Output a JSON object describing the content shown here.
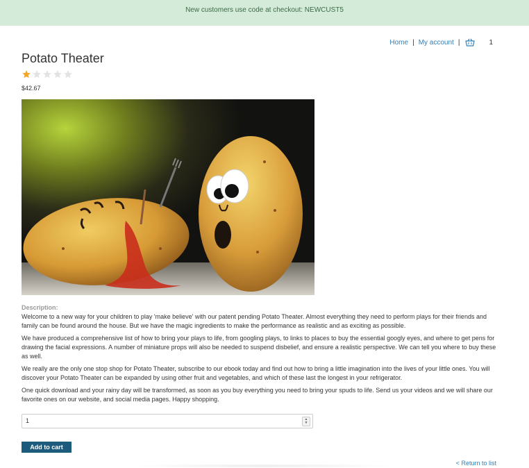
{
  "banner": {
    "text": "New customers use code at checkout: NEWCUST5"
  },
  "nav": {
    "home": "Home",
    "separator": "|",
    "my_account": "My account",
    "cart_icon": "basket-icon",
    "cart_count": "1"
  },
  "product": {
    "title": "Potato Theater",
    "rating": {
      "value": 1,
      "max": 5
    },
    "price": "$42.67",
    "image_alt": "product-photo"
  },
  "description": {
    "label": "Description:",
    "paragraphs": [
      "Welcome to a new way for your children to play 'make believe' with our patent pending Potato Theater. Almost everything they need to perform plays for their friends and family can be found around the house. But we have the magic ingredients to make the performance as realistic and as exciting as possible.",
      "We have produced a comprehensive list of how to bring your plays to life, from googling plays, to links to places to buy the essential googly eyes, and where to get pens for drawing the facial expressions. A number of miniature props will also be needed to suspend disbelief, and ensure a realistic perspective. We can tell you where to buy these as well.",
      "We really are the only one stop shop for Potato Theater, subscribe to our ebook today and find out how to bring a little imagination into the lives of your little ones. You will discover your Potato Theater can be expanded by using other fruit and vegetables, and which of these last the longest in your refrigerator.",
      "One quick download and your rainy day will be transformed, as soon as you buy everything you need to bring your spuds to life. Send us your videos and we will share our favorite ones on our website, and social media pages. Happy shopping."
    ]
  },
  "quantity": {
    "value": "1"
  },
  "add_to_cart": "Add to cart",
  "return_link": "< Return to list",
  "colors": {
    "banner_bg": "#d4ebd9",
    "link": "#2f7fb8",
    "button": "#1d5b7d",
    "star_filled": "#f5a623",
    "star_empty": "#e3e3e3"
  }
}
